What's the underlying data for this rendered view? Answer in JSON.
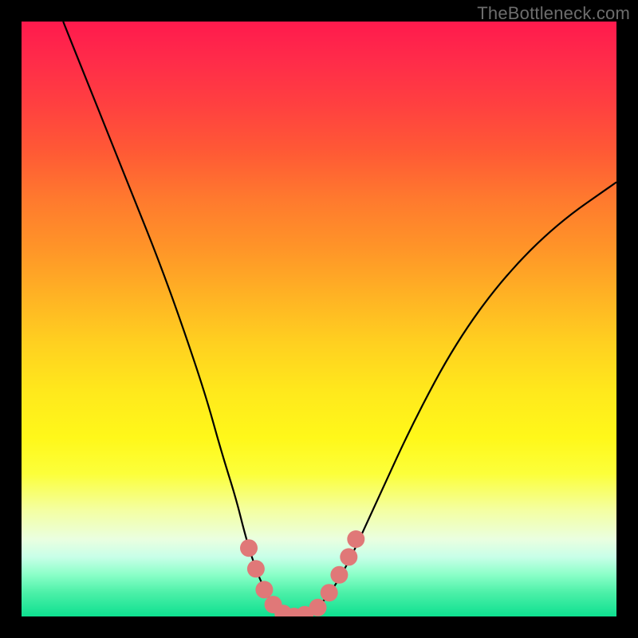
{
  "watermark": "TheBottleneck.com",
  "chart_data": {
    "type": "line",
    "title": "",
    "xlabel": "",
    "ylabel": "",
    "xlim": [
      0,
      100
    ],
    "ylim": [
      0,
      100
    ],
    "series": [
      {
        "name": "bottleneck-curve",
        "x": [
          7,
          11,
          15,
          19,
          23,
          27,
          31,
          33.5,
          36,
          37.5,
          39,
          41,
          43,
          44,
          45.5,
          48,
          51,
          55,
          60,
          66,
          73,
          81,
          90,
          100
        ],
        "y": [
          100,
          90,
          80,
          70,
          60,
          49,
          37,
          28,
          20,
          14,
          9,
          4,
          1,
          0,
          0,
          0.5,
          2.5,
          9,
          20,
          33,
          46,
          57,
          66,
          73
        ]
      }
    ],
    "markers": {
      "name": "highlight-dots",
      "color": "#e07878",
      "points": [
        {
          "x": 38.2,
          "y": 11.5
        },
        {
          "x": 39.4,
          "y": 8
        },
        {
          "x": 40.8,
          "y": 4.5
        },
        {
          "x": 42.3,
          "y": 2
        },
        {
          "x": 44,
          "y": 0.5
        },
        {
          "x": 45.8,
          "y": 0
        },
        {
          "x": 47.6,
          "y": 0.3
        },
        {
          "x": 49.8,
          "y": 1.5
        },
        {
          "x": 51.7,
          "y": 4
        },
        {
          "x": 53.4,
          "y": 7
        },
        {
          "x": 55,
          "y": 10
        },
        {
          "x": 56.2,
          "y": 13
        }
      ]
    },
    "background": {
      "type": "rainbow-vertical-gradient",
      "top": "#ff1a4d",
      "bottom": "#0ee090"
    }
  }
}
